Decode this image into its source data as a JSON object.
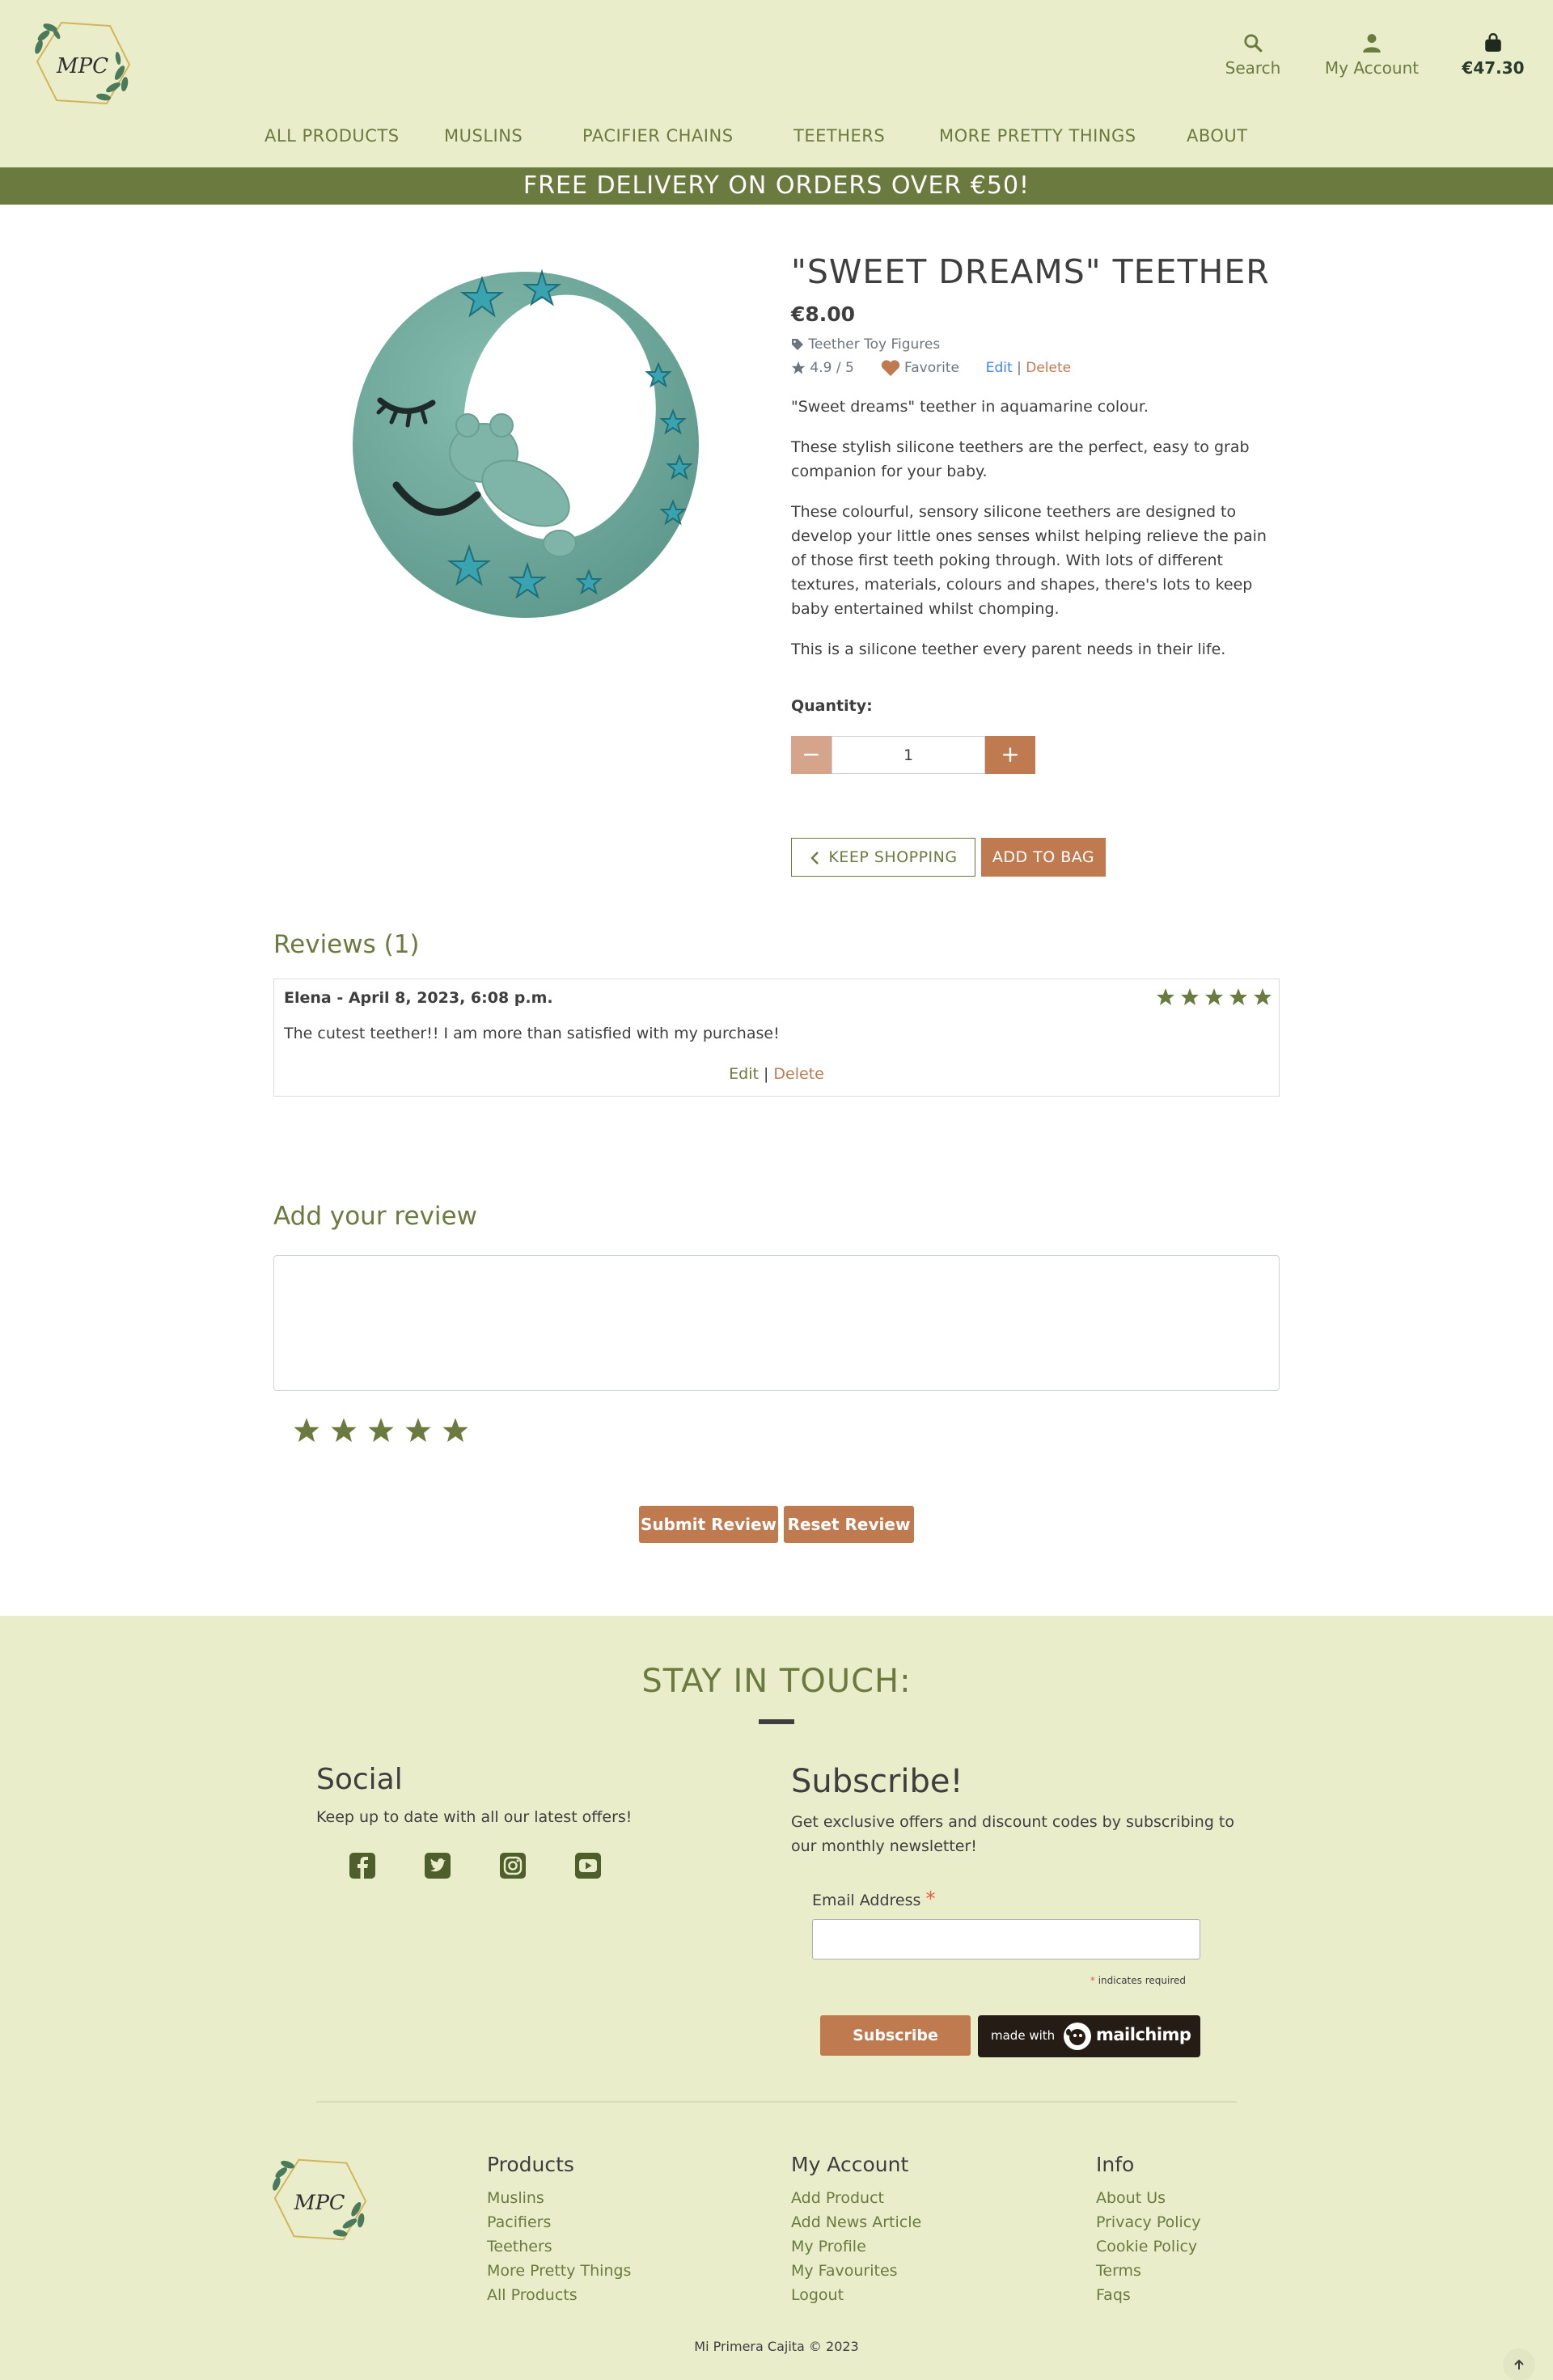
{
  "header": {
    "search_label": "Search",
    "account_label": "My Account",
    "bag_total": "€47.30",
    "logo_text": "MPC"
  },
  "nav": {
    "items": [
      "ALL PRODUCTS",
      "MUSLINS",
      "PACIFIER CHAINS",
      "TEETHERS",
      "MORE PRETTY THINGS",
      "ABOUT"
    ]
  },
  "promo": {
    "text": "FREE DELIVERY ON ORDERS OVER €50!"
  },
  "product": {
    "title": "\"SWEET DREAMS\" TEETHER",
    "price": "€8.00",
    "category": "Teether Toy Figures",
    "rating": "4.9 / 5",
    "favorite_label": "Favorite",
    "edit_label": "Edit",
    "separator": "|",
    "delete_label": "Delete",
    "description": [
      "\"Sweet dreams\" teether in aquamarine colour.",
      "These stylish silicone teethers are the perfect, easy to grab companion for your baby.",
      "These colourful, sensory silicone teethers are designed to develop your little ones senses whilst helping relieve the pain of those first teeth poking through. With lots of different textures, materials, colours and shapes, there's lots to keep baby entertained whilst chomping.",
      "This is a silicone teether every parent needs in their life."
    ],
    "quantity_label": "Quantity:",
    "quantity_value": "1",
    "minus_symbol": "−",
    "plus_symbol": "+",
    "keep_shopping_label": "KEEP SHOPPING",
    "add_to_bag_label": "ADD TO BAG"
  },
  "reviews": {
    "heading": "Reviews (1)",
    "items": [
      {
        "author_line": "Elena - April 8, 2023, 6:08 p.m.",
        "stars": 5,
        "text": "The cutest teether!! I am more than satisfied with my purchase!",
        "edit_label": "Edit",
        "separator": "|",
        "delete_label": "Delete"
      }
    ],
    "add_heading": "Add your review",
    "rating_stars": 5,
    "submit_label": "Submit Review",
    "reset_label": "Reset Review"
  },
  "footer": {
    "stay_heading": "STAY IN TOUCH:",
    "social_heading": "Social",
    "social_text": "Keep up to date with all our latest offers!",
    "social_icons": [
      "facebook-icon",
      "twitter-icon",
      "instagram-icon",
      "youtube-icon"
    ],
    "subscribe_heading": "Subscribe!",
    "subscribe_text": "Get exclusive offers and discount codes by subscribing to our monthly newsletter!",
    "email_label": "Email Address",
    "required_marker": "*",
    "required_note": "indicates required",
    "subscribe_button": "Subscribe",
    "mailchimp_made_with": "made with",
    "mailchimp_brand": "mailchimp",
    "columns": [
      {
        "heading": "Products",
        "links": [
          "Muslins",
          "Pacifiers",
          "Teethers",
          "More Pretty Things",
          "All Products"
        ]
      },
      {
        "heading": "My Account",
        "links": [
          "Add Product",
          "Add News Article",
          "My Profile",
          "My Favourites",
          "Logout"
        ]
      },
      {
        "heading": "Info",
        "links": [
          "About Us",
          "Privacy Policy",
          "Cookie Policy",
          "Terms",
          "Faqs"
        ]
      }
    ],
    "copyright": "Mi Primera Cajita © 2023"
  },
  "colors": {
    "header_bg": "#e9edca",
    "olive": "#6b7a3e",
    "accent": "#c07a50",
    "text": "#3e3e3e",
    "teether": "#6fa89c"
  }
}
